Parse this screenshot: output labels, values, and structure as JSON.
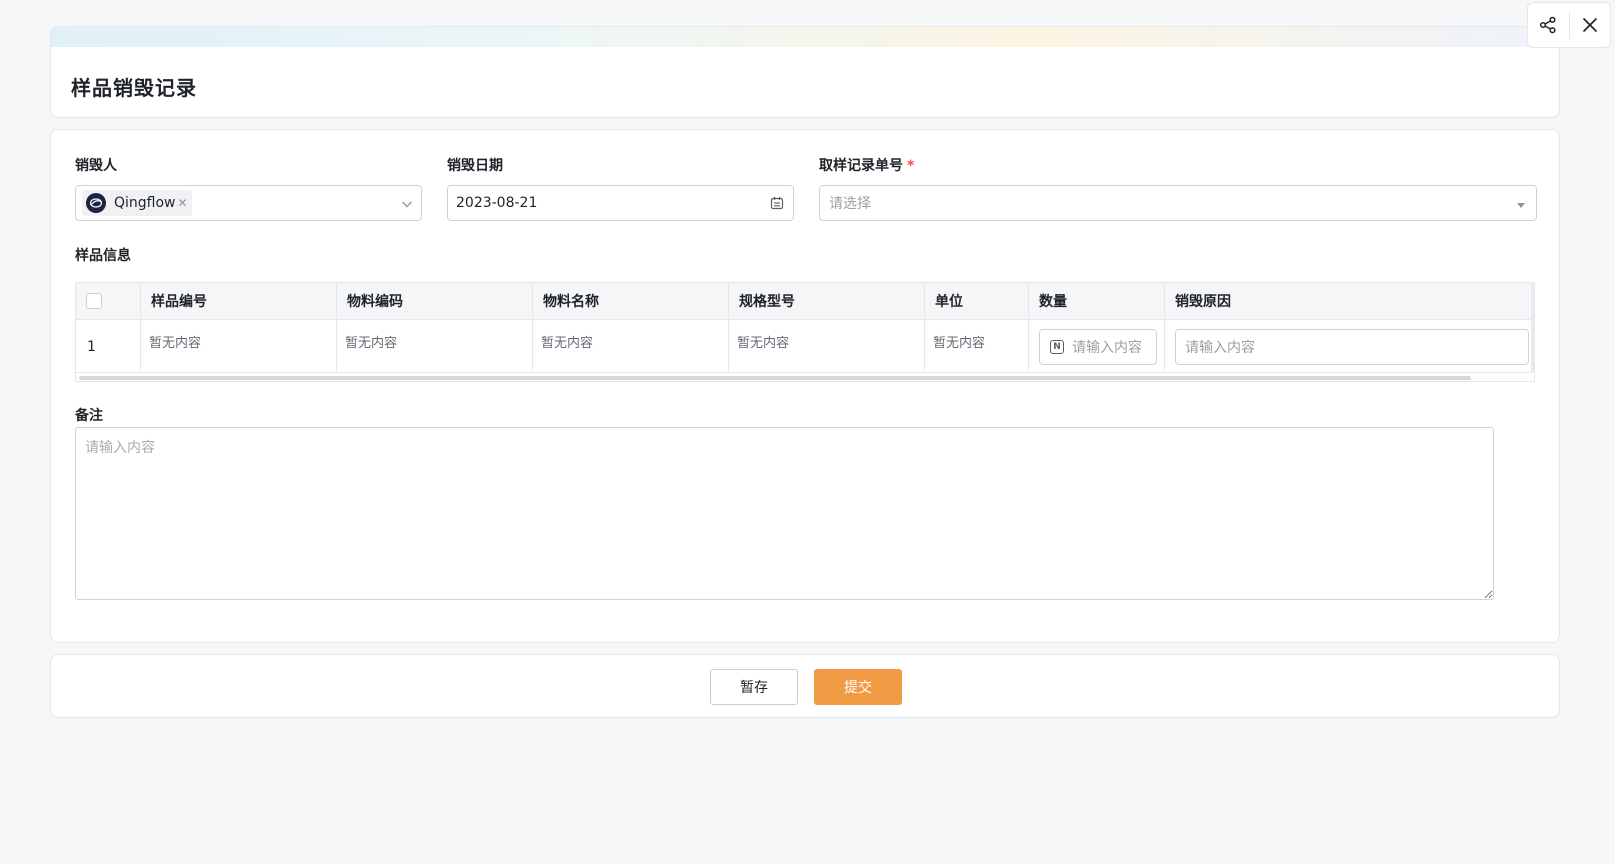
{
  "header": {
    "title": "样品销毁记录"
  },
  "actions": {
    "share_icon": "share-icon",
    "close_icon": "close-icon"
  },
  "form": {
    "destroyer": {
      "label": "销毁人",
      "selected_user": "Qingflow"
    },
    "destroy_date": {
      "label": "销毁日期",
      "value": "2023-08-21"
    },
    "sampling_record_no": {
      "label": "取样记录单号",
      "required_mark": "*",
      "placeholder": "请选择"
    },
    "sample_info": {
      "label": "样品信息",
      "columns": [
        "样品编号",
        "物料编码",
        "物料名称",
        "规格型号",
        "单位",
        "数量",
        "销毁原因"
      ],
      "rows": [
        {
          "index": "1",
          "sample_no": "暂无内容",
          "material_code": "暂无内容",
          "material_name": "暂无内容",
          "spec_model": "暂无内容",
          "unit": "暂无内容",
          "quantity_placeholder": "请输入内容",
          "reason_placeholder": "请输入内容"
        }
      ]
    },
    "remark": {
      "label": "备注",
      "placeholder": "请输入内容"
    }
  },
  "footer": {
    "save_draft_label": "暂存",
    "submit_label": "提交"
  },
  "colors": {
    "primary": "#f29b45",
    "required": "#f54a45",
    "background": "#f6f7f9"
  }
}
